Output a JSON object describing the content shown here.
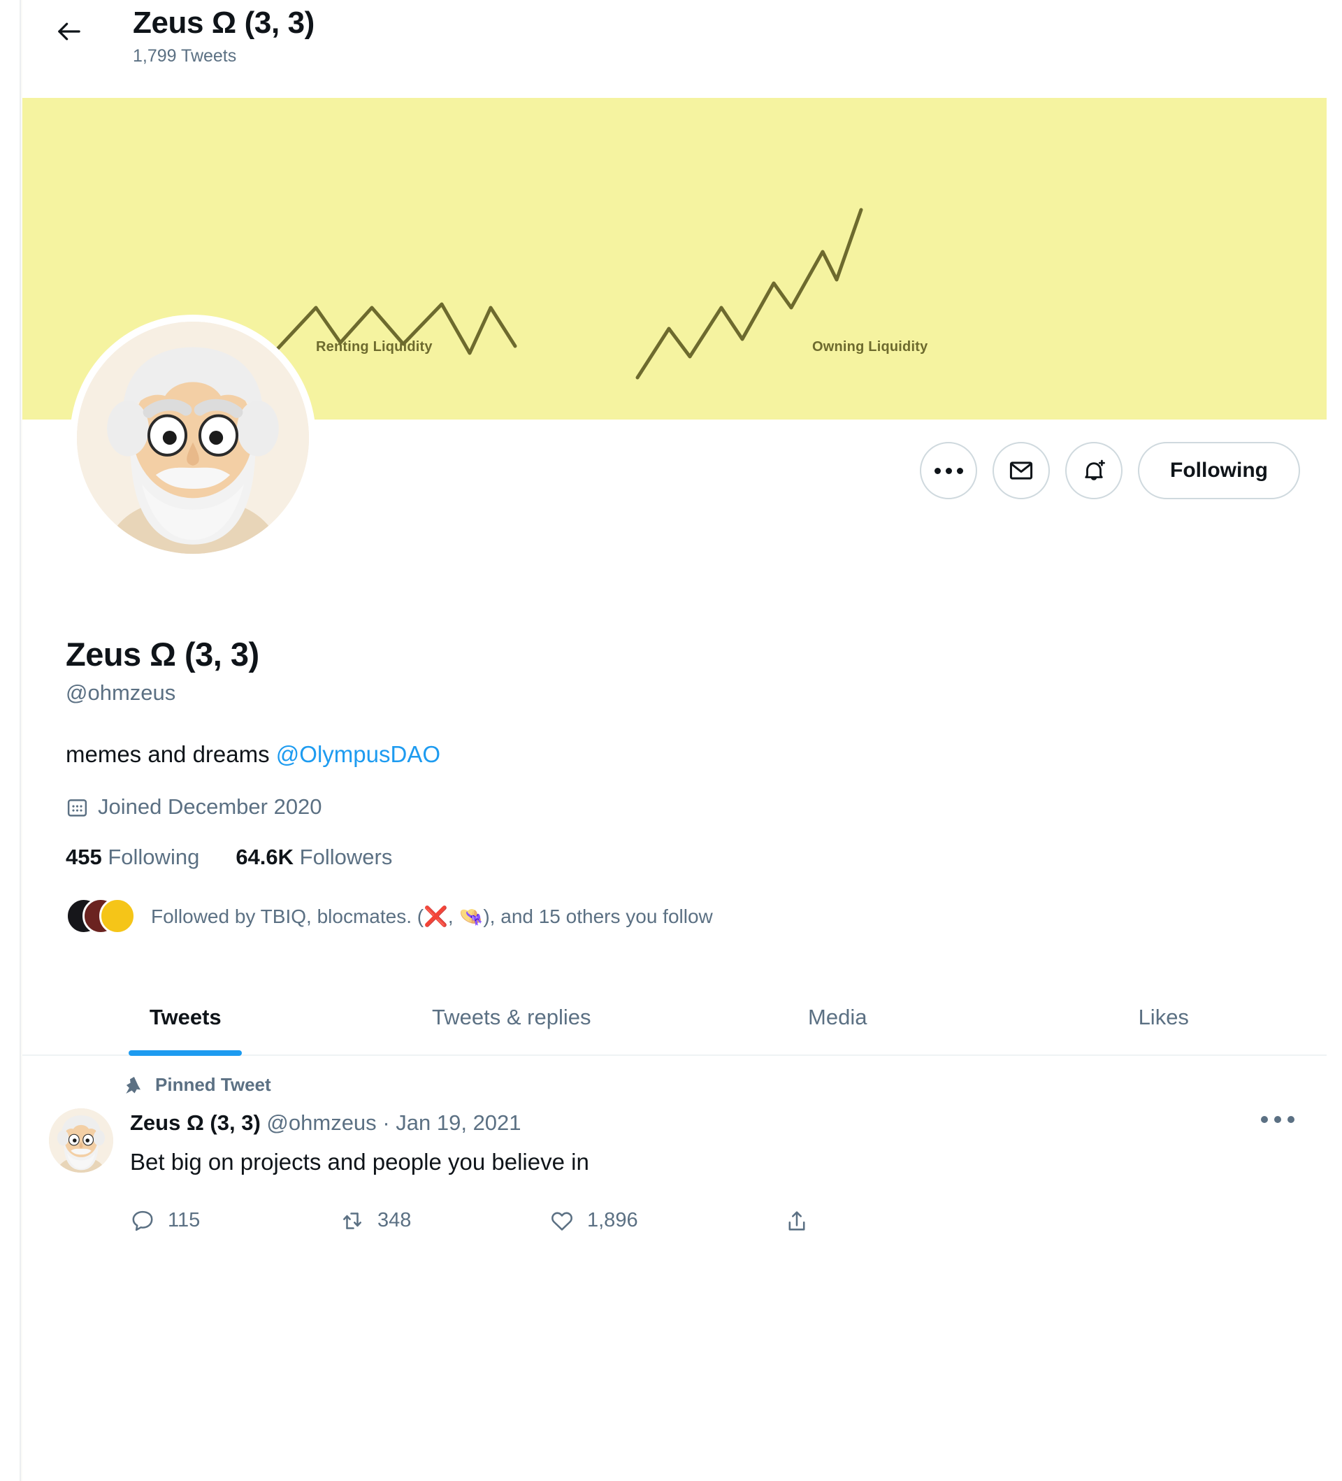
{
  "topbar": {
    "back_icon": "arrow-left-icon",
    "name": "Zeus Ω (3, 3)",
    "tweet_count": "1,799 Tweets"
  },
  "banner": {
    "background_color": "#f5f3a0",
    "line_color": "#6d6a2e",
    "labels": {
      "left": "Renting Liquidity",
      "right": "Owning Liquidity"
    }
  },
  "actions": {
    "more_label": "more-options",
    "message_label": "message",
    "notify_label": "notifications",
    "follow_label": "Following"
  },
  "profile": {
    "display_name": "Zeus Ω (3, 3)",
    "handle": "@ohmzeus",
    "bio_text": "memes and dreams ",
    "bio_mention": "@OlympusDAO",
    "joined": "Joined December 2020",
    "following_count": "455",
    "following_label": "Following",
    "followers_count": "64.6K",
    "followers_label": "Followers",
    "followed_by": "Followed by TBIQ, blocmates. (❌, 👒), and 15 others you follow"
  },
  "tabs": [
    {
      "label": "Tweets",
      "active": true
    },
    {
      "label": "Tweets & replies",
      "active": false
    },
    {
      "label": "Media",
      "active": false
    },
    {
      "label": "Likes",
      "active": false
    }
  ],
  "tweet": {
    "pinned_label": "Pinned Tweet",
    "author_name": "Zeus Ω (3, 3)",
    "author_handle": "@ohmzeus",
    "separator": "·",
    "date": "Jan 19, 2021",
    "text": "Bet big on projects and people you believe in",
    "replies": "115",
    "retweets": "348",
    "likes": "1,896"
  },
  "colors": {
    "accent": "#1d9bf0",
    "muted": "#5b7083",
    "text": "#0f1419"
  }
}
